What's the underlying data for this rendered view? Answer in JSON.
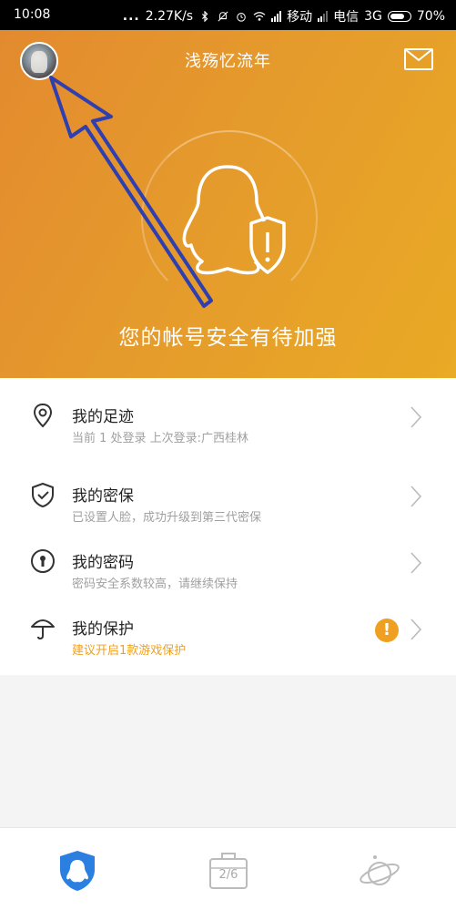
{
  "status_bar": {
    "time": "10:08",
    "dots": "...",
    "speed": "2.27K/s",
    "carrier1": "移动",
    "carrier2": "电信",
    "network": "3G",
    "battery": "70%"
  },
  "header": {
    "title": "浅殇忆流年",
    "headline": "您的帐号安全有待加强",
    "accent_color": "#e59a2c"
  },
  "list": [
    {
      "title": "我的足迹",
      "subtitle": "当前 1 处登录 上次登录:广西桂林",
      "icon": "location-pin-icon"
    },
    {
      "title": "我的密保",
      "subtitle": "已设置人脸，成功升级到第三代密保",
      "icon": "shield-check-icon"
    },
    {
      "title": "我的密码",
      "subtitle": "密码安全系数较高，请继续保持",
      "icon": "keyhole-icon"
    },
    {
      "title": "我的保护",
      "subtitle": "建议开启1款游戏保护",
      "icon": "umbrella-icon",
      "alert": "!"
    }
  ],
  "bottom_tabs": {
    "box_label": "2/6"
  }
}
